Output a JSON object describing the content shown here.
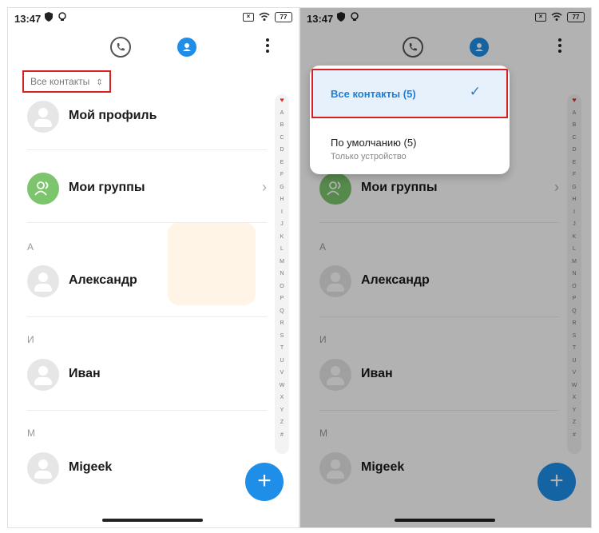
{
  "status": {
    "time": "13:47",
    "battery": "77"
  },
  "filter": {
    "label": "Все контакты",
    "chevron": "⌃⌄"
  },
  "rows": {
    "profile": "Мой профиль",
    "groups": "Мои группы",
    "contacts": [
      "Александр",
      "Иван",
      "Migeek"
    ]
  },
  "sections": [
    "А",
    "И",
    "M"
  ],
  "index_letters": [
    "A",
    "B",
    "C",
    "D",
    "E",
    "F",
    "G",
    "H",
    "I",
    "J",
    "K",
    "L",
    "M",
    "N",
    "O",
    "P",
    "Q",
    "R",
    "S",
    "T",
    "U",
    "V",
    "W",
    "X",
    "Y",
    "Z",
    "#"
  ],
  "popup": {
    "option1": "Все контакты (5)",
    "option2": "По умолчанию (5)",
    "option2_sub": "Только устройство"
  },
  "fab": "+",
  "colors": {
    "accent": "#1e8ee9",
    "highlight": "#d92020",
    "group_avatar": "#7cc56d"
  }
}
